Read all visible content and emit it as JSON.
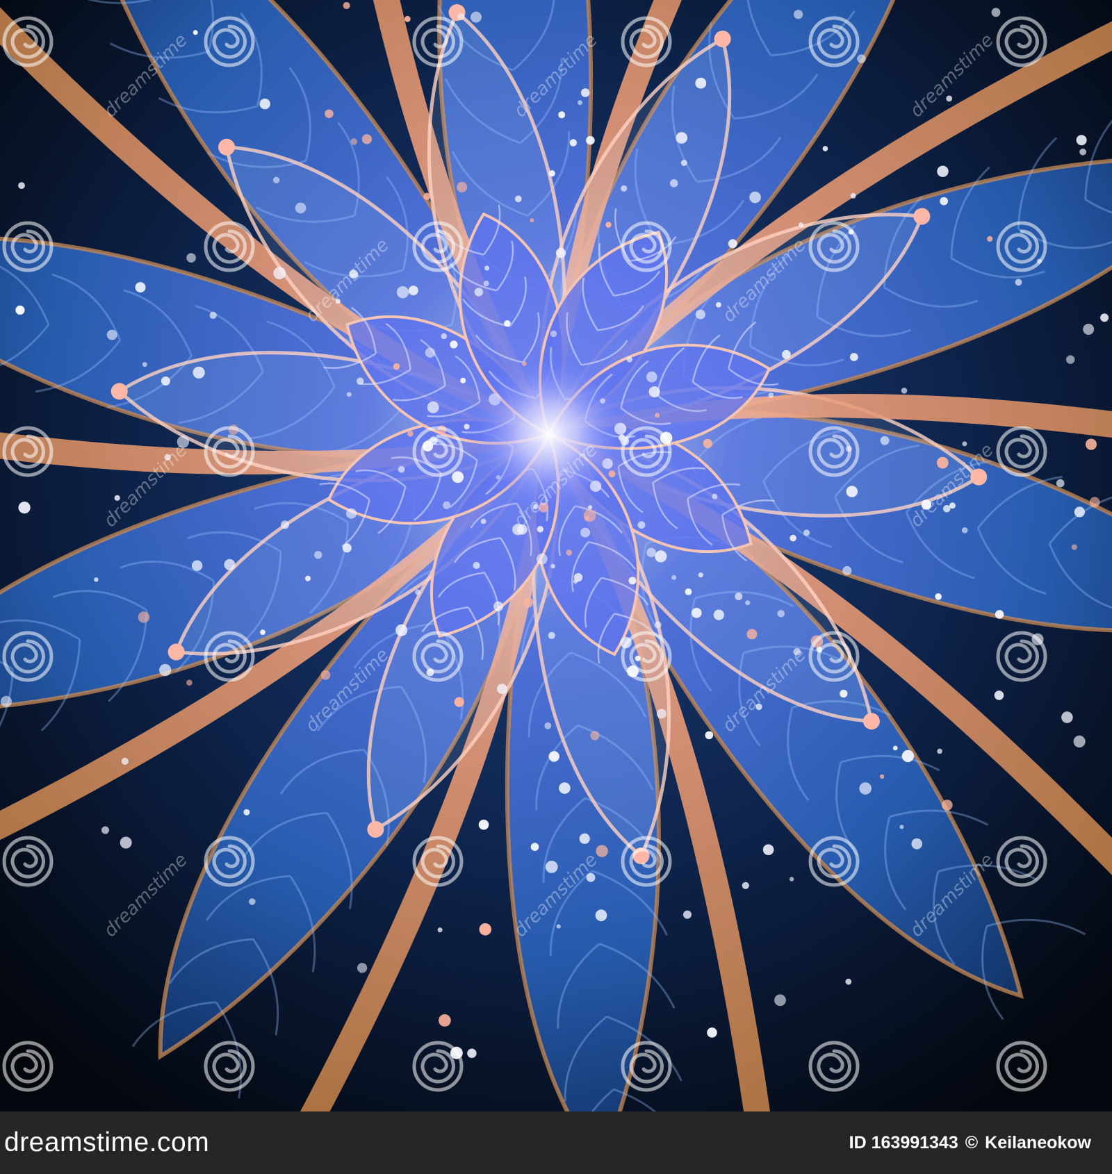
{
  "image": {
    "subject": "fractal-flower-artwork",
    "colors": {
      "background": "#05080f",
      "petal_blue": "#2d6fc4",
      "petal_deep": "#163a78",
      "center_glow": "#f2f0ff",
      "stem_orange": "#c98a52",
      "stem_pink": "#f0a08c",
      "footer_bg": "#262626"
    }
  },
  "watermark": {
    "text": "dreamstime",
    "icon": "spiral-icon"
  },
  "footer": {
    "brand": "dreamstime.com",
    "id_label": "ID 163991343",
    "separator": "©",
    "author": "Keilaneokow"
  }
}
